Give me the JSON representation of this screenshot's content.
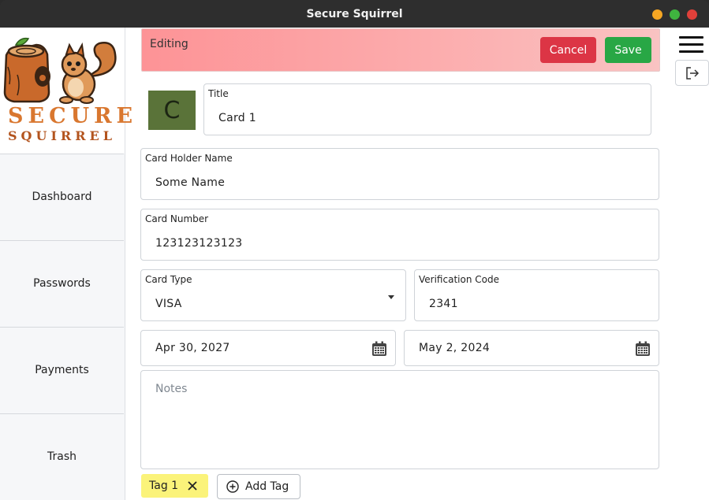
{
  "window": {
    "title": "Secure Squirrel"
  },
  "logo": {
    "line1": "SECURE",
    "line2": "SQUIRREL"
  },
  "sidebar": {
    "items": [
      {
        "label": "Dashboard"
      },
      {
        "label": "Passwords"
      },
      {
        "label": "Payments"
      },
      {
        "label": "Trash"
      }
    ]
  },
  "banner": {
    "label": "Editing",
    "cancel_label": "Cancel",
    "save_label": "Save"
  },
  "avatar": {
    "letter": "C",
    "color": "#5a7339"
  },
  "form": {
    "title": {
      "label": "Title",
      "value": "Card 1"
    },
    "card_holder": {
      "label": "Card Holder Name",
      "value": "Some Name"
    },
    "card_number": {
      "label": "Card Number",
      "value": "123123123123"
    },
    "card_type": {
      "label": "Card Type",
      "value": "VISA"
    },
    "verification_code": {
      "label": "Verification Code",
      "value": "2341"
    },
    "expiry_date": {
      "value": "Apr 30, 2027"
    },
    "second_date": {
      "value": "May 2, 2024"
    },
    "notes": {
      "placeholder": "Notes"
    }
  },
  "tags": {
    "items": [
      {
        "label": "Tag 1"
      }
    ],
    "add_label": "Add Tag"
  },
  "colors": {
    "cancel": "#dc3545",
    "save": "#28a745",
    "tag_background": "#fbf37a",
    "banner": "#fd9396"
  }
}
